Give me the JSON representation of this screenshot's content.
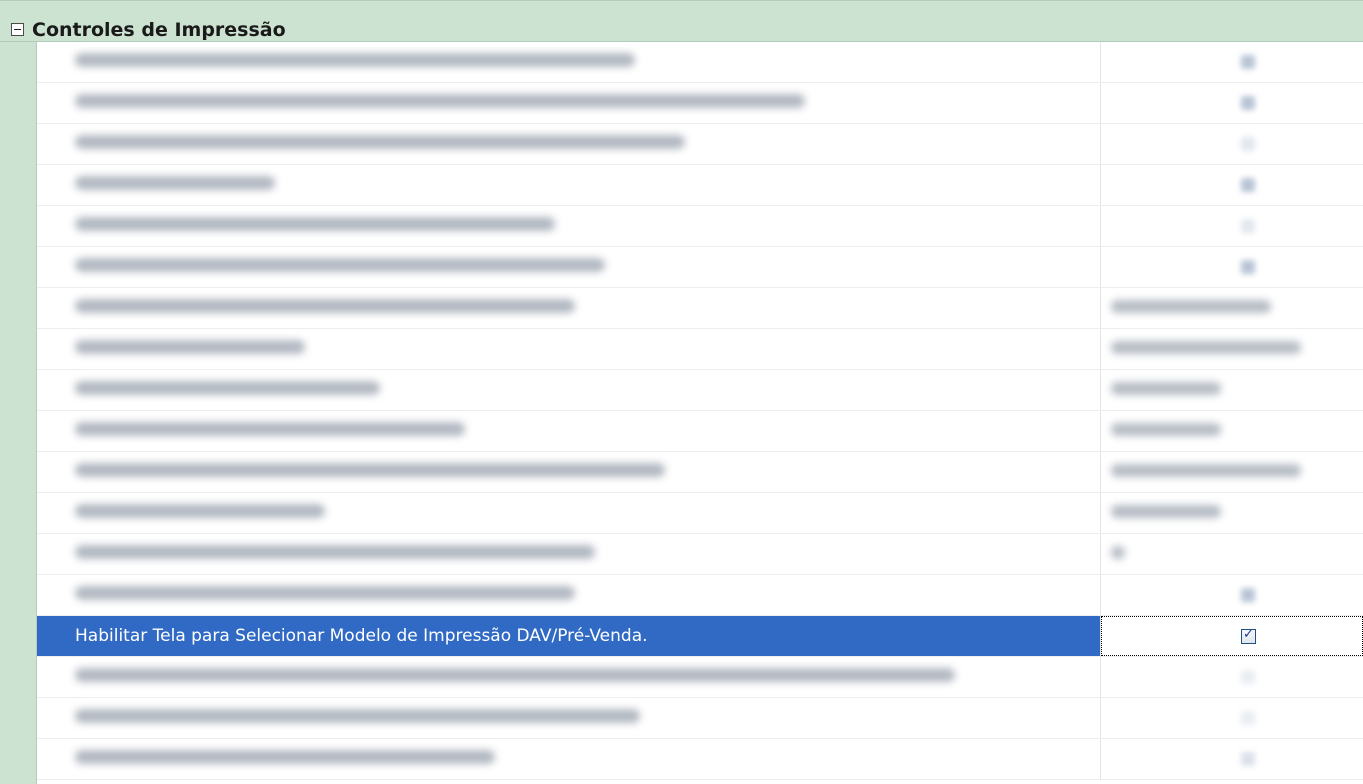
{
  "category": {
    "title": "Controles de Impressão",
    "expanded": true,
    "icon": "collapse-minus-icon"
  },
  "selected_row": {
    "label": "Habilitar Tela para Selecionar Modelo de Impressão DAV/Pré-Venda.",
    "checked": true,
    "icon": "checkbox-checked-icon"
  },
  "colors": {
    "category_bg": "#cde3d2",
    "selection_bg": "#316ac5",
    "selection_text": "#ffffff"
  }
}
